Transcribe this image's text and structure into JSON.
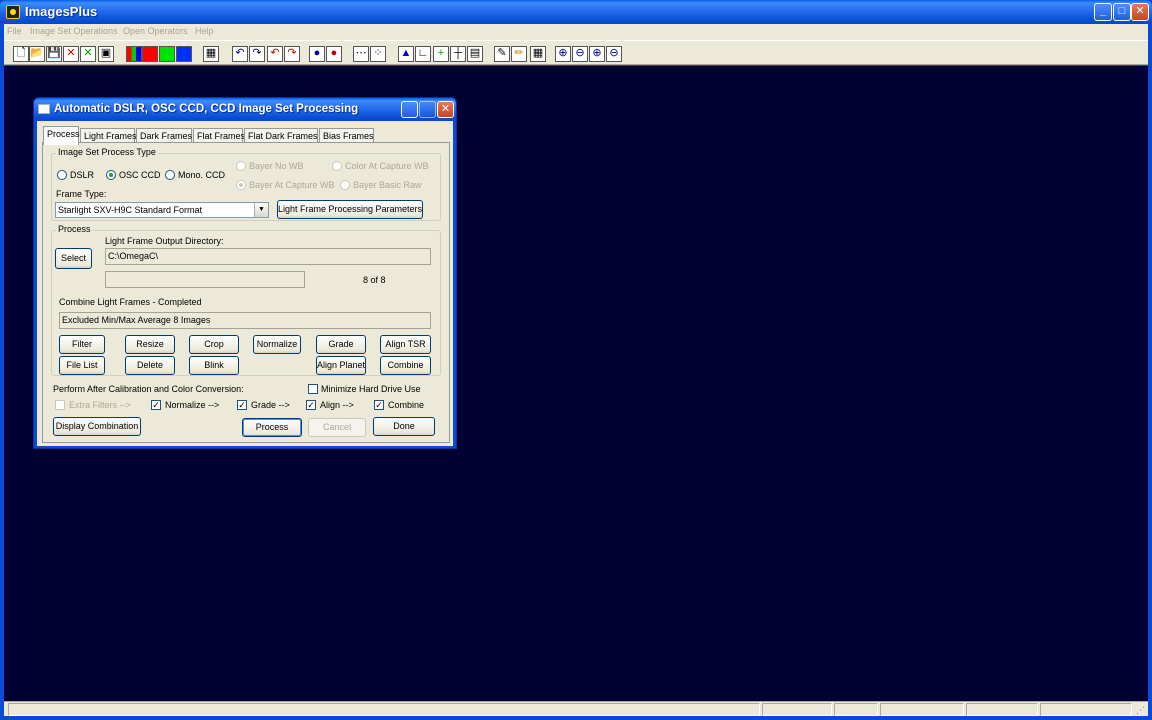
{
  "app": {
    "title": "ImagesPlus"
  },
  "menu": [
    "File",
    "Image Set Operations",
    "Open Operators",
    "Help"
  ],
  "toolbar_icons": [
    {
      "name": "new-file-icon",
      "glyph": "🗋"
    },
    {
      "name": "open-folder-icon",
      "glyph": "📂"
    },
    {
      "name": "save-icon",
      "glyph": "💾"
    },
    {
      "name": "close-red-icon",
      "glyph": "✕"
    },
    {
      "name": "close-green-icon",
      "glyph": "✕"
    },
    {
      "name": "window-icon",
      "glyph": "▣"
    },
    {
      "name": "rgb-icon",
      "glyph": ""
    },
    {
      "name": "red-channel-icon",
      "glyph": ""
    },
    {
      "name": "green-channel-icon",
      "glyph": ""
    },
    {
      "name": "blue-channel-icon",
      "glyph": ""
    },
    {
      "name": "grid-icon",
      "glyph": "▦"
    },
    {
      "name": "undo-icon",
      "glyph": "↶"
    },
    {
      "name": "redo-icon",
      "glyph": "↷"
    },
    {
      "name": "undo-red-icon",
      "glyph": "↶"
    },
    {
      "name": "redo-red-icon",
      "glyph": "↷"
    },
    {
      "name": "dot-blue-icon",
      "glyph": "●"
    },
    {
      "name": "dot-red-icon",
      "glyph": "●"
    },
    {
      "name": "dots-icon",
      "glyph": "⋯"
    },
    {
      "name": "points-icon",
      "glyph": "⁘"
    },
    {
      "name": "histogram-icon",
      "glyph": "▲"
    },
    {
      "name": "curve-icon",
      "glyph": "∟"
    },
    {
      "name": "crosshair-green-icon",
      "glyph": "+"
    },
    {
      "name": "crosshair-icon",
      "glyph": "┼"
    },
    {
      "name": "table-icon",
      "glyph": "▤"
    },
    {
      "name": "brush-icon",
      "glyph": "✎"
    },
    {
      "name": "pencil-icon",
      "glyph": "✏"
    },
    {
      "name": "matrix-icon",
      "glyph": "▦"
    },
    {
      "name": "zoom-in-icon",
      "glyph": "⊕"
    },
    {
      "name": "zoom-out-icon",
      "glyph": "⊖"
    },
    {
      "name": "zoom-fit-icon",
      "glyph": "⊕"
    },
    {
      "name": "zoom-reset-icon",
      "glyph": "⊖"
    }
  ],
  "dialog": {
    "title": "Automatic DSLR, OSC CCD, CCD Image Set Processing",
    "tabs": [
      "Process",
      "Light Frames",
      "Dark Frames",
      "Flat Frames",
      "Flat Dark Frames",
      "Bias Frames"
    ],
    "process_type": {
      "group_label": "Image Set Process Type",
      "options": [
        "DSLR",
        "OSC CCD",
        "Mono. CCD"
      ],
      "selected": "OSC CCD",
      "bayer_options": [
        "Bayer No WB",
        "Color At Capture WB",
        "Bayer At Capture WB",
        "Bayer Basic Raw"
      ],
      "bayer_selected": "Bayer At Capture WB",
      "frame_type_label": "Frame Type:",
      "frame_type_value": "Starlight SXV-H9C Standard Format",
      "params_button": "Light Frame Processing Parameters"
    },
    "process": {
      "group_label": "Process",
      "select_button": "Select",
      "output_dir_label": "Light Frame Output Directory:",
      "output_dir_value": "C:\\OmegaC\\",
      "progress_count": "8  of  8",
      "status_label": "Combine Light Frames - Completed",
      "status_detail": "Excluded Min/Max Average 8 Images",
      "buttons_row1": [
        "Filter",
        "Resize",
        "Crop",
        "Normalize",
        "Grade",
        "Align TSR"
      ],
      "buttons_row2": [
        "File List",
        "Delete",
        "Blink",
        "Align Planet",
        "Combine"
      ]
    },
    "after": {
      "label": "Perform After Calibration and Color Conversion:",
      "minimize_label": "Minimize Hard Drive Use",
      "minimize_checked": false,
      "options": [
        {
          "label": "Extra Filters -->",
          "checked": false,
          "disabled": true
        },
        {
          "label": "Normalize -->",
          "checked": true,
          "disabled": false
        },
        {
          "label": "Grade -->",
          "checked": true,
          "disabled": false
        },
        {
          "label": "Align -->",
          "checked": true,
          "disabled": false
        },
        {
          "label": "Combine",
          "checked": true,
          "disabled": false
        }
      ]
    },
    "footer": {
      "display_combination": "Display Combination",
      "process": "Process",
      "cancel": "Cancel",
      "done": "Done"
    }
  },
  "colors": {
    "workspace": "#010032",
    "titlebar": "#0a52d8",
    "dialog_face": "#ece9d8"
  }
}
